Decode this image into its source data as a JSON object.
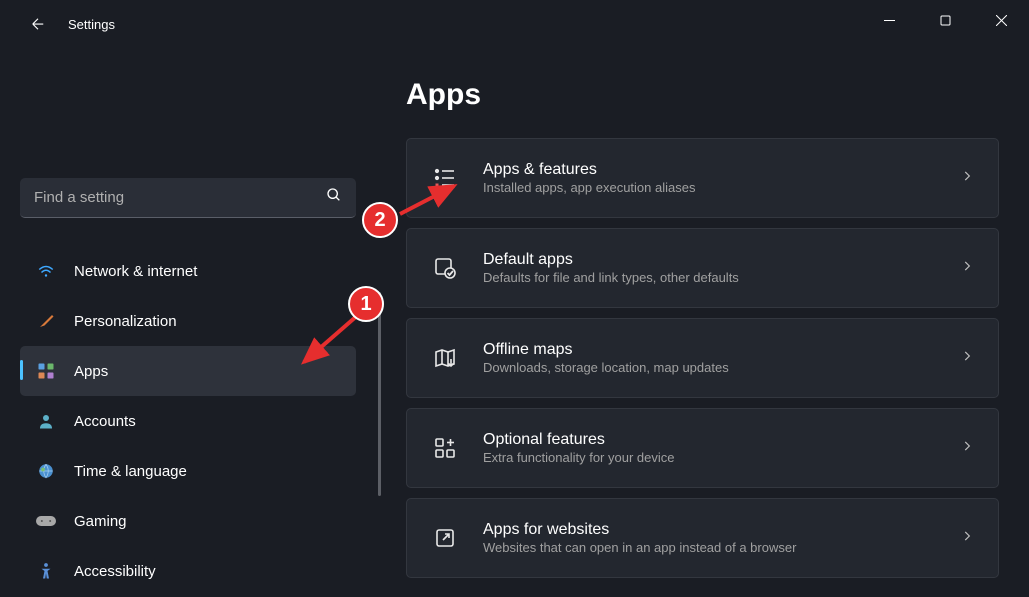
{
  "app": {
    "title": "Settings"
  },
  "search": {
    "placeholder": "Find a setting"
  },
  "sidebar": {
    "items": [
      {
        "label": "Network & internet",
        "icon": "wifi"
      },
      {
        "label": "Personalization",
        "icon": "brush"
      },
      {
        "label": "Apps",
        "icon": "apps",
        "selected": true
      },
      {
        "label": "Accounts",
        "icon": "person"
      },
      {
        "label": "Time & language",
        "icon": "globe"
      },
      {
        "label": "Gaming",
        "icon": "gamepad"
      },
      {
        "label": "Accessibility",
        "icon": "accessibility"
      }
    ]
  },
  "page": {
    "heading": "Apps",
    "cards": [
      {
        "title": "Apps & features",
        "subtitle": "Installed apps, app execution aliases"
      },
      {
        "title": "Default apps",
        "subtitle": "Defaults for file and link types, other defaults"
      },
      {
        "title": "Offline maps",
        "subtitle": "Downloads, storage location, map updates"
      },
      {
        "title": "Optional features",
        "subtitle": "Extra functionality for your device"
      },
      {
        "title": "Apps for websites",
        "subtitle": "Websites that can open in an app instead of a browser"
      }
    ]
  },
  "annotations": {
    "badge1": "1",
    "badge2": "2"
  }
}
